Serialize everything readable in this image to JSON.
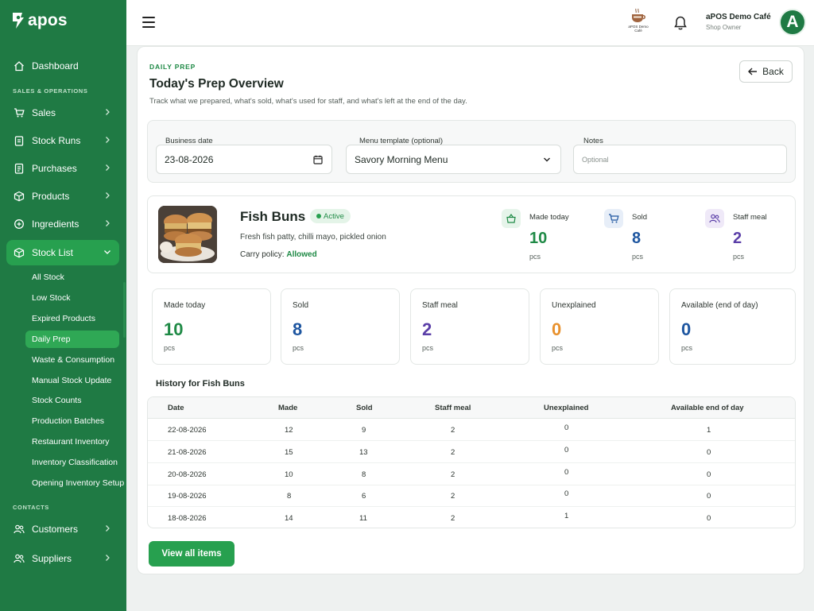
{
  "app": {
    "logo_text": "apos",
    "shop_logo_text": "aPOS Demo Café",
    "user_name": "aPOS Demo Café",
    "user_role": "Shop Owner",
    "avatar_letter": "A"
  },
  "sidebar": {
    "dashboard": "Dashboard",
    "section_sales": "SALES & OPERATIONS",
    "sales": "Sales",
    "stock_runs": "Stock Runs",
    "purchases": "Purchases",
    "products": "Products",
    "ingredients": "Ingredients",
    "stock_list": "Stock List",
    "sub_items": [
      "All Stock",
      "Low Stock",
      "Expired Products",
      "Daily Prep",
      "Waste & Consumption",
      "Manual Stock Update",
      "Stock Counts",
      "Production Batches",
      "Restaurant Inventory",
      "Inventory Classification",
      "Opening Inventory Setup"
    ],
    "active_sub": "Daily Prep",
    "section_contacts": "CONTACTS",
    "customers": "Customers",
    "suppliers": "Suppliers"
  },
  "page": {
    "eyebrow": "DAILY PREP",
    "title": "Today's Prep Overview",
    "subtitle": "Track what we prepared, what's sold, what's used for staff, and what's left at the end of the day.",
    "back_label": "Back"
  },
  "filters": {
    "date_label": "Business date",
    "date_value": "23-08-2026",
    "template_label": "Menu template (optional)",
    "template_value": "Savory Morning Menu",
    "notes_label": "Notes",
    "notes_placeholder": "Optional"
  },
  "product": {
    "name": "Fish Buns",
    "status": "Active",
    "description": "Fresh fish patty, chilli mayo, pickled onion",
    "carry_label": "Carry policy:",
    "carry_value": "Allowed",
    "mini_stats": [
      {
        "label": "Made today",
        "value": "10",
        "unit": "pcs",
        "color": "#1f8a46"
      },
      {
        "label": "Sold",
        "value": "8",
        "unit": "pcs",
        "color": "#1e56a0"
      },
      {
        "label": "Staff meal",
        "value": "2",
        "unit": "pcs",
        "color": "#5b3fa8"
      }
    ]
  },
  "stats": [
    {
      "label": "Made today",
      "value": "10",
      "unit": "pcs",
      "color": "#1f8a46"
    },
    {
      "label": "Sold",
      "value": "8",
      "unit": "pcs",
      "color": "#1e56a0"
    },
    {
      "label": "Staff meal",
      "value": "2",
      "unit": "pcs",
      "color": "#5b3fa8"
    },
    {
      "label": "Unexplained",
      "value": "0",
      "unit": "pcs",
      "color": "#e8912d"
    },
    {
      "label": "Available (end of day)",
      "value": "0",
      "unit": "pcs",
      "color": "#1e56a0"
    }
  ],
  "history": {
    "title": "History for Fish Buns",
    "columns": [
      "Date",
      "Made",
      "Sold",
      "Staff meal",
      "Unexplained",
      "Available end of day"
    ],
    "rows": [
      [
        "22-08-2026",
        "12",
        "9",
        "2",
        "0",
        "1"
      ],
      [
        "21-08-2026",
        "15",
        "13",
        "2",
        "0",
        "0"
      ],
      [
        "20-08-2026",
        "10",
        "8",
        "2",
        "0",
        "0"
      ],
      [
        "19-08-2026",
        "8",
        "6",
        "2",
        "0",
        "0"
      ],
      [
        "18-08-2026",
        "14",
        "11",
        "2",
        "1",
        "0"
      ]
    ]
  },
  "actions": {
    "view_all": "View all items"
  }
}
